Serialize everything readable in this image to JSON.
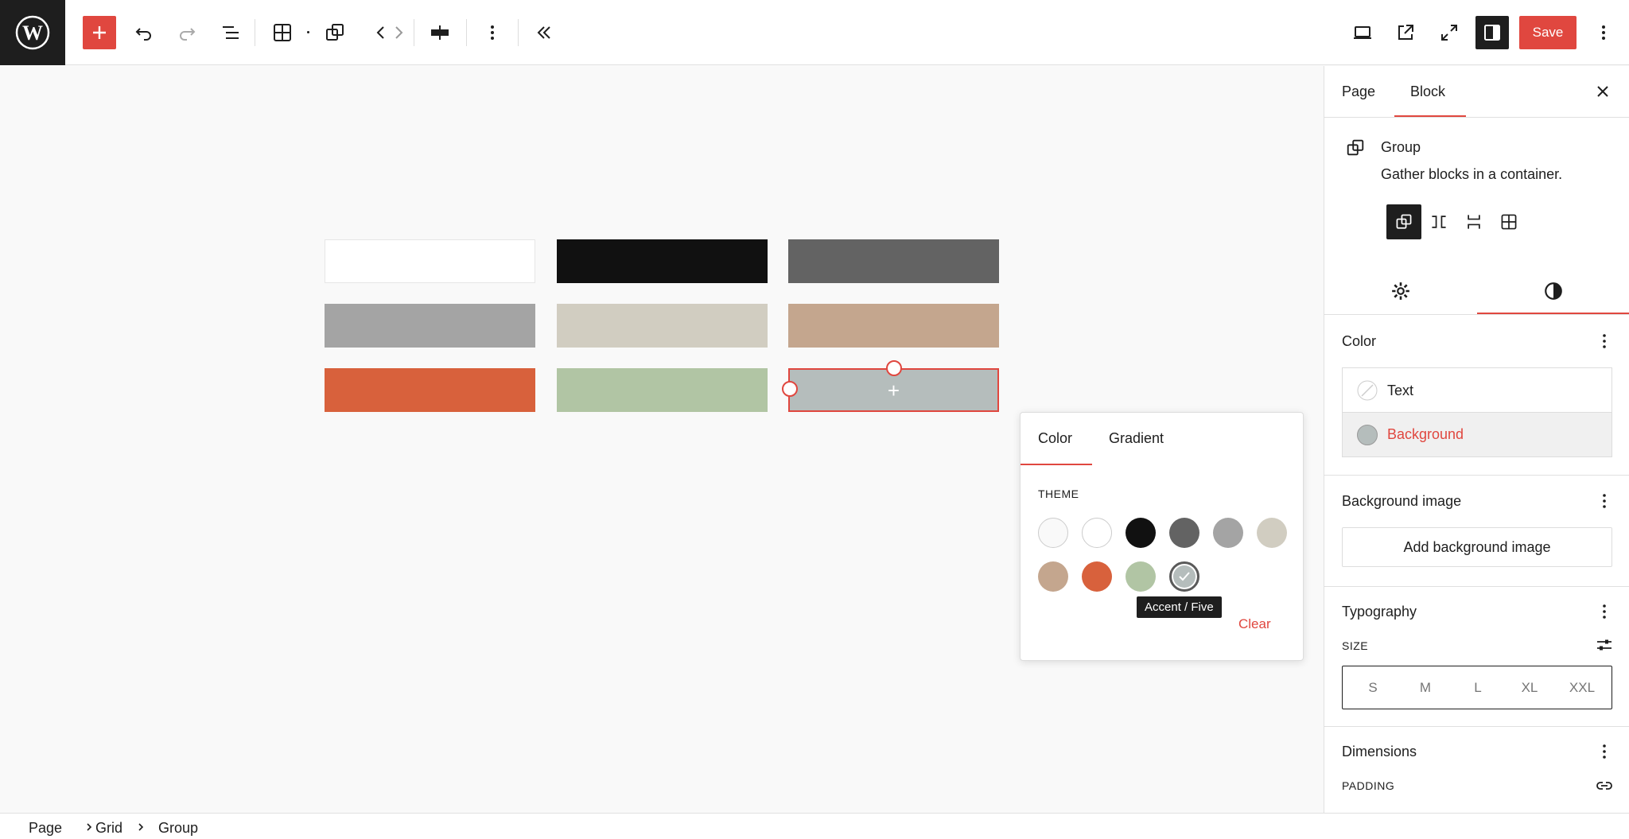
{
  "toolbar": {
    "save_label": "Save",
    "icons": [
      "wordpress-logo",
      "plus-icon",
      "undo-icon",
      "redo-icon",
      "list-view-icon",
      "grid-icon",
      "group-icon",
      "code-navigation-icon",
      "align-icon",
      "more-vertical-icon",
      "collapse-icon",
      "desktop-preview-icon",
      "external-view-icon",
      "fullscreen-icon",
      "sidebar-toggle-icon",
      "options-icon"
    ]
  },
  "canvas": {
    "swatch_colors": [
      "#ffffff",
      "#111111",
      "#636363",
      "#a4a4a4",
      "#d1cdc1",
      "#c4a68e",
      "#d8613c",
      "#b1c5a4",
      "#b5bdbc"
    ]
  },
  "popover": {
    "tabs": [
      "Color",
      "Gradient"
    ],
    "section_label": "THEME",
    "palette": [
      "#f9f9f9",
      "#ffffff",
      "#111111",
      "#636363",
      "#a4a4a4",
      "#d1cdc1",
      "#c4a68e",
      "#d8613c",
      "#b1c5a4",
      "#b5bdbc"
    ],
    "tooltip": "Accent / Five",
    "clear_label": "Clear"
  },
  "sidebar": {
    "tabs": [
      "Page",
      "Block"
    ],
    "block": {
      "title": "Group",
      "description": "Gather blocks in a container."
    },
    "color": {
      "title": "Color",
      "text_label": "Text",
      "background_label": "Background"
    },
    "background_image": {
      "title": "Background image",
      "button_label": "Add background image"
    },
    "typography": {
      "title": "Typography",
      "size_label": "SIZE",
      "sizes": [
        "S",
        "M",
        "L",
        "XL",
        "XXL"
      ]
    },
    "dimensions": {
      "title": "Dimensions",
      "padding_label": "PADDING"
    }
  },
  "breadcrumb": [
    "Page",
    "Grid",
    "Group"
  ],
  "colors": {
    "accent": "#e0473f",
    "selected_background": "#b5bdbc"
  }
}
